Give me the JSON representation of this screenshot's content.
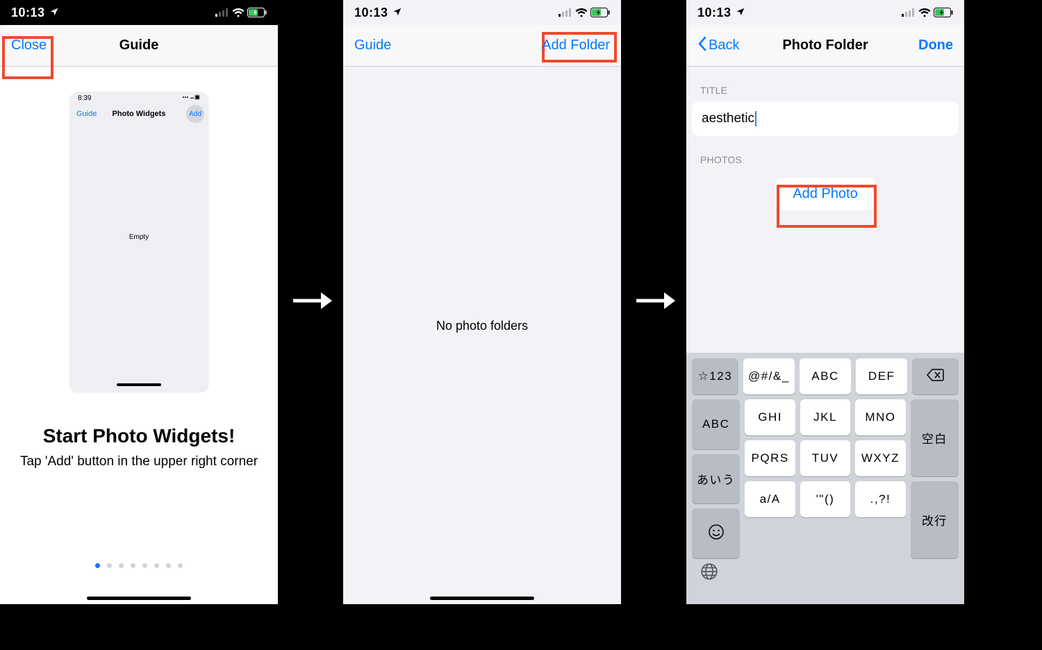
{
  "status": {
    "time": "10:13",
    "p1_time": "10:13"
  },
  "screen1": {
    "nav_close": "Close",
    "nav_title": "Guide",
    "mini": {
      "time": "8:39",
      "guide": "Guide",
      "title": "Photo Widgets",
      "add": "Add",
      "empty": "Empty"
    },
    "headline": "Start Photo Widgets!",
    "sub": "Tap 'Add' button in the upper right corner",
    "dot_count": 8,
    "active_dot": 0
  },
  "screen2": {
    "nav_guide": "Guide",
    "nav_add": "Add Folder",
    "empty": "No photo folders"
  },
  "screen3": {
    "nav_back": "Back",
    "nav_title": "Photo Folder",
    "nav_done": "Done",
    "title_label": "TITLE",
    "title_value": "aesthetic",
    "photos_label": "PHOTOS",
    "add_photo": "Add Photo",
    "keyboard": {
      "row1": [
        "☆123",
        "@#/&_",
        "ABC",
        "DEF"
      ],
      "row1_delete": "⌫",
      "left": [
        "ABC",
        "あいう"
      ],
      "mid": [
        [
          "GHI",
          "JKL",
          "MNO"
        ],
        [
          "PQRS",
          "TUV",
          "WXYZ"
        ],
        [
          "a/A",
          "'\"()",
          ".,?!"
        ]
      ],
      "right": [
        "空白",
        "改行"
      ],
      "emoji": "☺"
    }
  }
}
